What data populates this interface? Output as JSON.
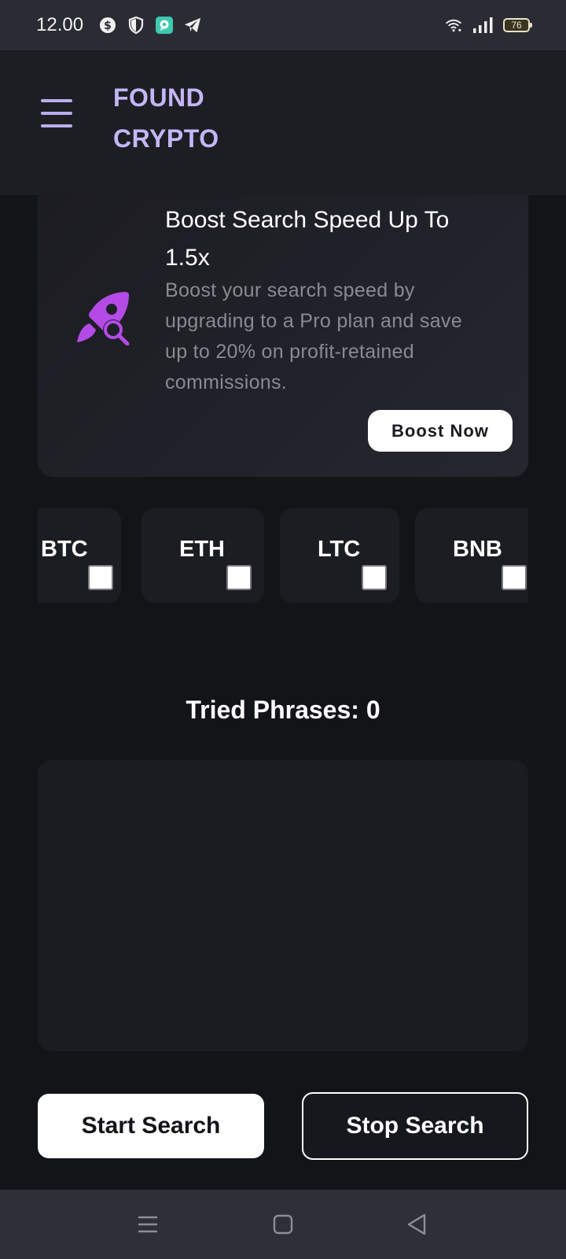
{
  "status_bar": {
    "time": "12.00",
    "battery": "76",
    "icons": [
      "dollar-circle-icon",
      "shield-icon",
      "chat-app-icon",
      "telegram-icon",
      "wifi-icon",
      "signal-icon",
      "battery-icon"
    ]
  },
  "header": {
    "title_line1": "FOUND",
    "title_line2": "CRYPTO",
    "menu_icon": "hamburger-menu-icon"
  },
  "promo": {
    "title_line1": "Boost Search Speed Up To",
    "title_line2": "1.5x",
    "description_lines": [
      "Boost your search speed by",
      "upgrading to a Pro plan and save",
      "up to 20% on profit-retained",
      "commissions."
    ],
    "button_label": "Boost Now",
    "icon": "rocket-search-icon"
  },
  "coins": [
    {
      "label": "BTC",
      "checked": false
    },
    {
      "label": "ETH",
      "checked": false
    },
    {
      "label": "LTC",
      "checked": false
    },
    {
      "label": "BNB",
      "checked": false
    }
  ],
  "tried_phrases": {
    "label": "Tried Phrases:",
    "count": "0"
  },
  "actions": {
    "start_label": "Start Search",
    "stop_label": "Stop Search"
  },
  "nav": {
    "icons": [
      "recent-apps-icon",
      "home-icon",
      "back-icon"
    ]
  },
  "colors": {
    "background": "#131418",
    "header": "#1d1e24",
    "accent": "#c4b6f6",
    "rocket": "#b44be6"
  }
}
